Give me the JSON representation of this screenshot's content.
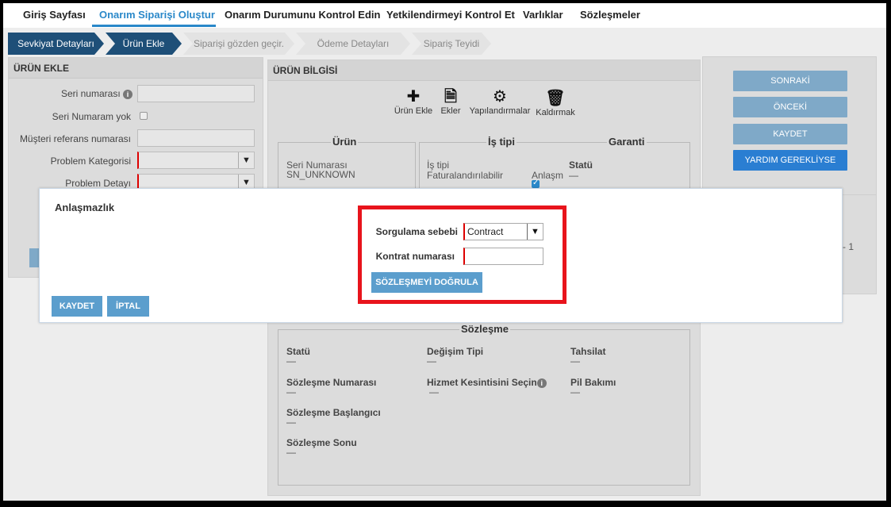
{
  "nav": {
    "items": [
      {
        "label": "Giriş Sayfası"
      },
      {
        "label": "Onarım Siparişi Oluştur"
      },
      {
        "label": "Onarım Durumunu Kontrol Edin"
      },
      {
        "label": "Yetkilendirmeyi Kontrol Et"
      },
      {
        "label": "Varlıklar"
      },
      {
        "label": "Sözleşmeler"
      }
    ],
    "active": "Onarım Siparişi Oluştur"
  },
  "steps": [
    "Sevkiyat Detayları",
    "Ürün Ekle",
    "Siparişi gözden geçir.",
    "Ödeme Detayları",
    "Sipariş Teyidi"
  ],
  "left_panel": {
    "title": "ÜRÜN EKLE",
    "serial_label": "Seri numarası",
    "no_serial_label": "Seri Numaram yok",
    "customer_ref_label": "Müşteri referans numarası",
    "problem_category_label": "Problem Kategorisi",
    "problem_detail_label": "Problem Detayı"
  },
  "product_info": {
    "title": "ÜRÜN BİLGİSİ",
    "toolbar": {
      "add_product": "Ürün Ekle",
      "attachments": "Ekler",
      "configurations": "Yapılandırmalar",
      "remove": "Kaldırmak"
    },
    "product_group": {
      "legend": "Ürün",
      "serial_label": "Seri Numarası",
      "serial_value": "SN_UNKNOWN"
    },
    "worktype_group": {
      "legend": "İş tipi",
      "worktype_label": "İş tipi",
      "worktype_value": "Faturalandırılabilir",
      "dispute_label": "Anlaşm"
    },
    "warranty_group": {
      "legend": "Garanti",
      "status_label": "Statü",
      "status_value": "—"
    },
    "contract_group": {
      "legend": "Sözleşme",
      "status_label": "Statü",
      "status_value": "—",
      "change_type_label": "Değişim Tipi",
      "change_type_value": "—",
      "collection_label": "Tahsilat",
      "collection_value": "—",
      "contract_no_label": "Sözleşme Numarası",
      "contract_no_value": "—",
      "service_interrupt_label": "Hizmet Kesintisini Seçin",
      "service_interrupt_value": "—",
      "battery_label": "Pil Bakımı",
      "battery_value": "—",
      "start_label": "Sözleşme Başlangıcı",
      "start_value": "—",
      "end_label": "Sözleşme Sonu",
      "end_value": "—"
    }
  },
  "right_panel": {
    "next": "SONRAKİ",
    "previous": "ÖNCEKİ",
    "save": "KAYDET",
    "help": "YARDIM GEREKLİYSE",
    "page_fragment": "- 1"
  },
  "modal": {
    "title": "Anlaşmazlık",
    "reason_label": "Sorgulama sebebi",
    "reason_value": "Contract",
    "contract_number_label": "Kontrat numarası",
    "contract_number_value": "",
    "verify_button": "SÖZLEŞMEYİ DOĞRULA",
    "save_button": "KAYDET",
    "cancel_button": "İPTAL"
  },
  "colors": {
    "accent": "#2a88c9",
    "step_done": "#1e4f78",
    "highlight": "#e8141c",
    "modal_button": "#5b9ecd"
  }
}
